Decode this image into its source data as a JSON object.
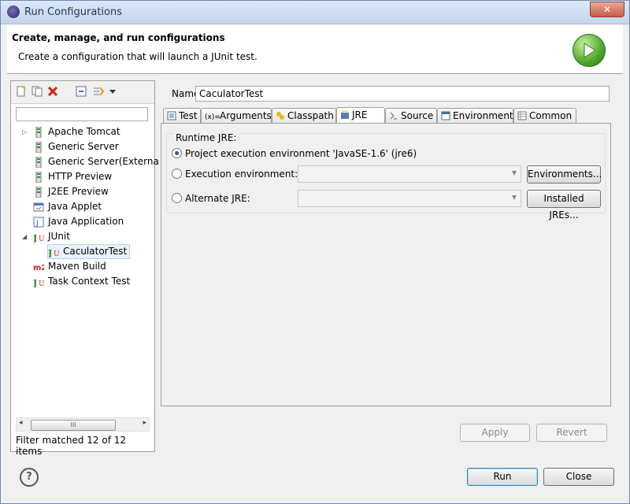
{
  "window": {
    "title": "Run Configurations",
    "close_glyph": "✕"
  },
  "banner": {
    "title": "Create, manage, and run configurations",
    "subtitle": "Create a configuration that will launch a JUnit test."
  },
  "left_panel": {
    "filter_value": "",
    "tree": [
      {
        "label": "Apache Tomcat",
        "icon": "server-icon",
        "level": 0,
        "expandable": true
      },
      {
        "label": "Generic Server",
        "icon": "server-icon",
        "level": 0
      },
      {
        "label": "Generic Server(Externa",
        "icon": "server-icon",
        "level": 0
      },
      {
        "label": "HTTP Preview",
        "icon": "server-icon",
        "level": 0
      },
      {
        "label": "J2EE Preview",
        "icon": "server-icon",
        "level": 0
      },
      {
        "label": "Java Applet",
        "icon": "applet-icon",
        "level": 0
      },
      {
        "label": "Java Application",
        "icon": "java-app-icon",
        "level": 0
      },
      {
        "label": "JUnit",
        "icon": "junit-icon",
        "level": 0,
        "expanded": true
      },
      {
        "label": "CaculatorTest",
        "icon": "junit-icon",
        "level": 1,
        "selected": true
      },
      {
        "label": "Maven Build",
        "icon": "maven-icon",
        "level": 0
      },
      {
        "label": "Task Context Test",
        "icon": "junit-icon",
        "level": 0
      }
    ],
    "filter_status": "Filter matched 12 of 12 items",
    "scroll_glyph": "III"
  },
  "config": {
    "name_label": "Name:",
    "name_value": "CaculatorTest",
    "tabs": [
      {
        "label": "Test",
        "icon": "test-tab-icon"
      },
      {
        "label": "Arguments",
        "icon": "arguments-tab-icon"
      },
      {
        "label": "Classpath",
        "icon": "classpath-tab-icon"
      },
      {
        "label": "JRE",
        "icon": "jre-tab-icon",
        "active": true
      },
      {
        "label": "Source",
        "icon": "source-tab-icon"
      },
      {
        "label": "Environment",
        "icon": "environment-tab-icon"
      },
      {
        "label": "Common",
        "icon": "common-tab-icon"
      }
    ],
    "jre": {
      "group_title": "Runtime JRE:",
      "option_project": "Project execution environment 'JavaSE-1.6' (jre6)",
      "option_execution": "Execution environment:",
      "option_alternate": "Alternate JRE:",
      "selected": "project",
      "environments_button": "Environments...",
      "installed_jres_button": "Installed JREs..."
    },
    "apply_button": "Apply",
    "revert_button": "Revert"
  },
  "footer": {
    "help_glyph": "?",
    "run_button": "Run",
    "close_button": "Close"
  }
}
